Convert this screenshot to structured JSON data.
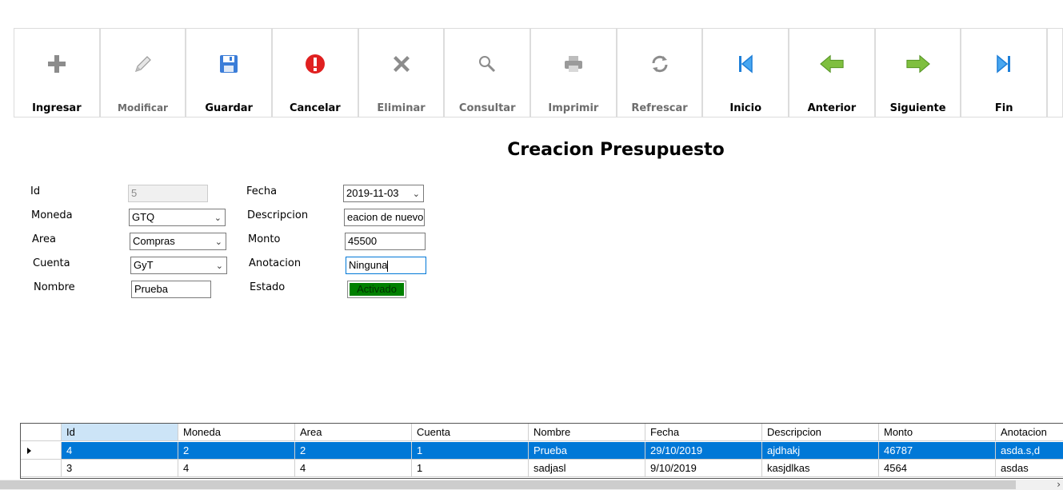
{
  "toolbar": {
    "buttons": [
      {
        "label": "Ingresar",
        "icon": "plus-icon"
      },
      {
        "label": "Modificar",
        "icon": "pencil-icon"
      },
      {
        "label": "Guardar",
        "icon": "save-icon"
      },
      {
        "label": "Cancelar",
        "icon": "alert-icon"
      },
      {
        "label": "Eliminar",
        "icon": "x-icon"
      },
      {
        "label": "Consultar",
        "icon": "search-icon"
      },
      {
        "label": "Imprimir",
        "icon": "printer-icon"
      },
      {
        "label": "Refrescar",
        "icon": "refresh-icon"
      },
      {
        "label": "Inicio",
        "icon": "first-icon"
      },
      {
        "label": "Anterior",
        "icon": "arrow-left-icon"
      },
      {
        "label": "Siguiente",
        "icon": "arrow-right-icon"
      },
      {
        "label": "Fin",
        "icon": "last-icon"
      }
    ]
  },
  "title": "Creacion Presupuesto",
  "form": {
    "labels": {
      "id": "Id",
      "moneda": "Moneda",
      "area": "Area",
      "cuenta": "Cuenta",
      "nombre": "Nombre",
      "fecha": "Fecha",
      "descripcion": "Descripcion",
      "monto": "Monto",
      "anotacion": "Anotacion",
      "estado": "Estado"
    },
    "values": {
      "id": "5",
      "moneda": "GTQ",
      "area": "Compras",
      "cuenta": "GyT",
      "nombre": "Prueba",
      "fecha": "2019-11-03",
      "descripcion": "eacion de nuevo",
      "monto": "45500",
      "anotacion": "Ninguna",
      "estado": "Activado"
    }
  },
  "grid": {
    "columns": [
      "Id",
      "Moneda",
      "Area",
      "Cuenta",
      "Nombre",
      "Fecha",
      "Descripcion",
      "Monto",
      "Anotacion"
    ],
    "rows": [
      [
        "4",
        "2",
        "2",
        "1",
        "Prueba",
        "29/10/2019",
        "ajdhakj",
        "46787",
        "asda.s,d"
      ],
      [
        "3",
        "4",
        "4",
        "1",
        "sadjasl",
        "9/10/2019",
        "kasjdlkas",
        "4564",
        "asdas"
      ]
    ]
  },
  "colors": {
    "selection": "#0078d7",
    "status_green": "#008000"
  }
}
